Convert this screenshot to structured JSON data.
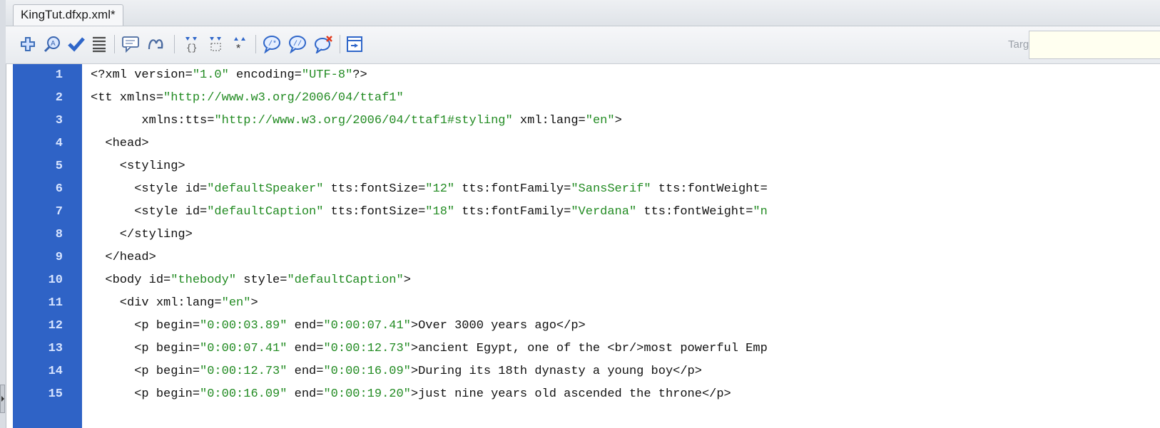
{
  "tab": {
    "label": "KingTut.dfxp.xml*"
  },
  "toolbar": {
    "target_label": "Target:",
    "buttons": [
      "expand-icon",
      "zoom-icon",
      "validate-icon",
      "format-icon",
      "comment-icon",
      "uncomment-icon",
      "collapse-full-tag-icon",
      "collapse-selection-icon",
      "expand-all-icon",
      "apply-comment-icon",
      "remove-comment-icon",
      "wrap-tag-icon",
      "move-css-icon"
    ]
  },
  "colors": {
    "gutter": "#2f63c6",
    "tag": "#111111",
    "attr_value": "#228b22"
  },
  "code": {
    "lines": [
      {
        "n": "1",
        "segs": [
          [
            "t",
            "<?xml version="
          ],
          [
            "v",
            "\"1.0\""
          ],
          [
            "t",
            " encoding="
          ],
          [
            "v",
            "\"UTF-8\""
          ],
          [
            "t",
            "?>"
          ]
        ]
      },
      {
        "n": "2",
        "segs": [
          [
            "t",
            "<tt xmlns="
          ],
          [
            "v",
            "\"http://www.w3.org/2006/04/ttaf1\""
          ]
        ]
      },
      {
        "n": "3",
        "segs": [
          [
            "t",
            "       xmlns:tts="
          ],
          [
            "v",
            "\"http://www.w3.org/2006/04/ttaf1#styling\""
          ],
          [
            "t",
            " xml:lang="
          ],
          [
            "v",
            "\"en\""
          ],
          [
            "t",
            ">"
          ]
        ]
      },
      {
        "n": "4",
        "segs": [
          [
            "t",
            "  <head>"
          ]
        ]
      },
      {
        "n": "5",
        "segs": [
          [
            "t",
            "    <styling>"
          ]
        ]
      },
      {
        "n": "6",
        "segs": [
          [
            "t",
            "      <style id="
          ],
          [
            "v",
            "\"defaultSpeaker\""
          ],
          [
            "t",
            " tts:fontSize="
          ],
          [
            "v",
            "\"12\""
          ],
          [
            "t",
            " tts:fontFamily="
          ],
          [
            "v",
            "\"SansSerif\""
          ],
          [
            "t",
            " tts:fontWeight="
          ]
        ]
      },
      {
        "n": "7",
        "segs": [
          [
            "t",
            "      <style id="
          ],
          [
            "v",
            "\"defaultCaption\""
          ],
          [
            "t",
            " tts:fontSize="
          ],
          [
            "v",
            "\"18\""
          ],
          [
            "t",
            " tts:fontFamily="
          ],
          [
            "v",
            "\"Verdana\""
          ],
          [
            "t",
            " tts:fontWeight="
          ],
          [
            "v",
            "\"n"
          ]
        ]
      },
      {
        "n": "8",
        "segs": [
          [
            "t",
            "    </styling>"
          ]
        ]
      },
      {
        "n": "9",
        "segs": [
          [
            "t",
            "  </head>"
          ]
        ]
      },
      {
        "n": "10",
        "segs": [
          [
            "t",
            "  <body id="
          ],
          [
            "v",
            "\"thebody\""
          ],
          [
            "t",
            " style="
          ],
          [
            "v",
            "\"defaultCaption\""
          ],
          [
            "t",
            ">"
          ]
        ]
      },
      {
        "n": "11",
        "segs": [
          [
            "t",
            "    <div xml:lang="
          ],
          [
            "v",
            "\"en\""
          ],
          [
            "t",
            ">"
          ]
        ]
      },
      {
        "n": "12",
        "segs": [
          [
            "t",
            "      <p begin="
          ],
          [
            "v",
            "\"0:00:03.89\""
          ],
          [
            "t",
            " end="
          ],
          [
            "v",
            "\"0:00:07.41\""
          ],
          [
            "t",
            ">Over 3000 years ago</p>"
          ]
        ]
      },
      {
        "n": "13",
        "segs": [
          [
            "t",
            "      <p begin="
          ],
          [
            "v",
            "\"0:00:07.41\""
          ],
          [
            "t",
            " end="
          ],
          [
            "v",
            "\"0:00:12.73\""
          ],
          [
            "t",
            ">ancient Egypt, one of the <br/>most powerful Emp"
          ]
        ]
      },
      {
        "n": "14",
        "segs": [
          [
            "t",
            "      <p begin="
          ],
          [
            "v",
            "\"0:00:12.73\""
          ],
          [
            "t",
            " end="
          ],
          [
            "v",
            "\"0:00:16.09\""
          ],
          [
            "t",
            ">During its 18th dynasty a young boy</p>"
          ]
        ]
      },
      {
        "n": "15",
        "segs": [
          [
            "t",
            "      <p begin="
          ],
          [
            "v",
            "\"0:00:16.09\""
          ],
          [
            "t",
            " end="
          ],
          [
            "v",
            "\"0:00:19.20\""
          ],
          [
            "t",
            ">just nine years old ascended the throne</p>"
          ]
        ]
      }
    ]
  }
}
